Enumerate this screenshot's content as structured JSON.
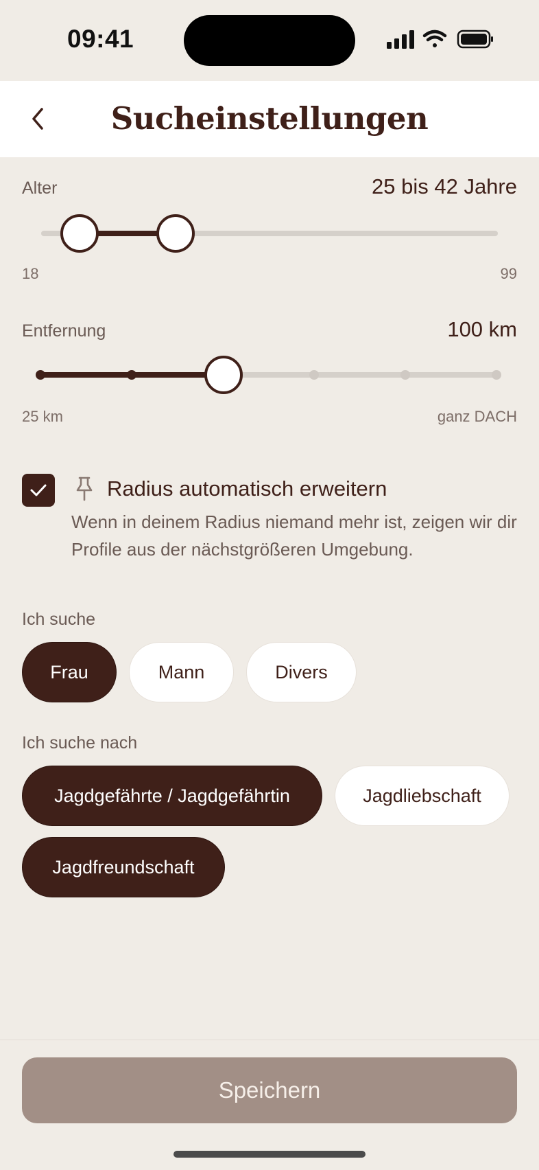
{
  "status": {
    "time": "09:41"
  },
  "header": {
    "title": "Sucheinstellungen"
  },
  "age": {
    "label": "Alter",
    "value_text": "25 bis 42 Jahre",
    "min_label": "18",
    "max_label": "99",
    "range_min": 18,
    "range_max": 99,
    "selected_min": 25,
    "selected_max": 42
  },
  "distance": {
    "label": "Entfernung",
    "value_text": "100 km",
    "min_label": "25 km",
    "max_label": "ganz DACH",
    "steps": 6,
    "selected_step": 2
  },
  "expand_radius": {
    "checked": true,
    "title": "Radius automatisch erweitern",
    "description": "Wenn in deinem Radius niemand mehr ist, zeigen wir dir Profile aus der nächstgrößeren Umgebung."
  },
  "search_gender": {
    "label": "Ich suche",
    "options": [
      {
        "label": "Frau",
        "selected": true
      },
      {
        "label": "Mann",
        "selected": false
      },
      {
        "label": "Divers",
        "selected": false
      }
    ]
  },
  "search_type": {
    "label": "Ich suche nach",
    "options": [
      {
        "label": "Jagdgefährte / Jagdgefährtin",
        "selected": true
      },
      {
        "label": "Jagdliebschaft",
        "selected": false
      },
      {
        "label": "Jagdfreundschaft",
        "selected": true
      }
    ]
  },
  "footer": {
    "save_label": "Speichern"
  },
  "colors": {
    "primary": "#3f2019",
    "background": "#f0ece6",
    "save_disabled": "#a28f86"
  }
}
